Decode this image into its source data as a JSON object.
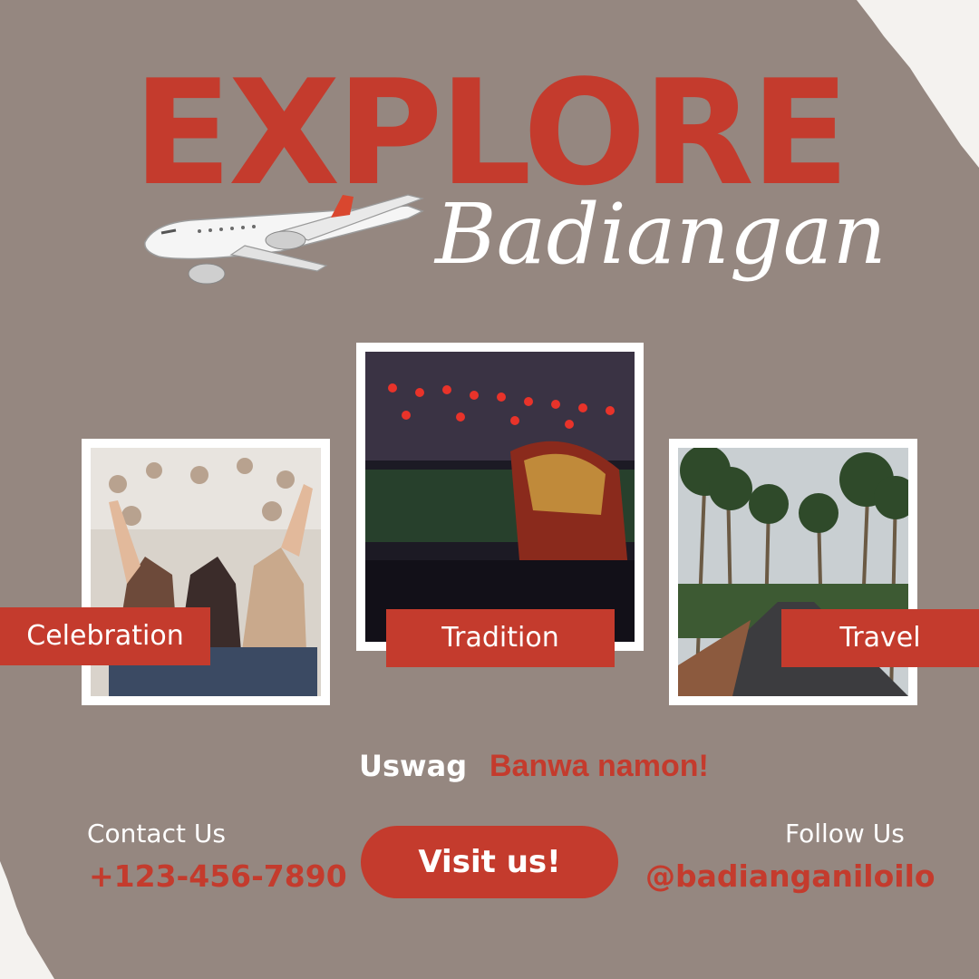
{
  "headline": "EXPLORE",
  "place_name": "Badiangan",
  "colors": {
    "accent": "#c43b2d",
    "background": "#958780",
    "paper": "#f4f2ef"
  },
  "cards": [
    {
      "label": "Celebration"
    },
    {
      "label": "Tradition"
    },
    {
      "label": "Travel"
    }
  ],
  "slogan": {
    "part1": "Uswag",
    "part2": "Banwa namon!"
  },
  "contact": {
    "title": "Contact Us",
    "phone": "+123-456-7890"
  },
  "follow": {
    "title": "Follow Us",
    "handle": "@badianganiloilo"
  },
  "cta": {
    "label": "Visit us!"
  }
}
